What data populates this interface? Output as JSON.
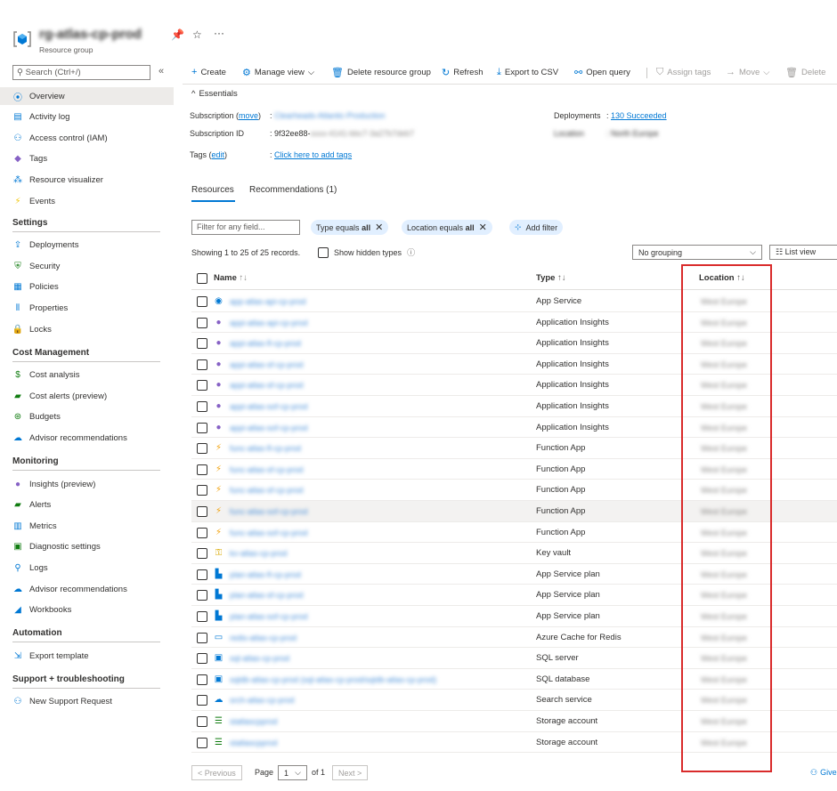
{
  "header": {
    "title": "rg-atlas-cp-prod",
    "subtitle": "Resource group",
    "pin_icon": "pin-icon",
    "star_icon": "star-icon",
    "more_icon": "ellipsis-icon"
  },
  "sidebar": {
    "search_placeholder": "Search (Ctrl+/)",
    "collapse": "«",
    "items": [
      {
        "label": "Overview",
        "icon": "overview-icon",
        "glyph": "⦿",
        "color": "#0078d4"
      },
      {
        "label": "Activity log",
        "icon": "activity-log-icon",
        "glyph": "▤",
        "color": "#0078d4"
      },
      {
        "label": "Access control (IAM)",
        "icon": "iam-icon",
        "glyph": "⚇",
        "color": "#0078d4"
      },
      {
        "label": "Tags",
        "icon": "tag-icon",
        "glyph": "◆",
        "color": "#8661c5"
      },
      {
        "label": "Resource visualizer",
        "icon": "visualizer-icon",
        "glyph": "⁂",
        "color": "#0078d4"
      },
      {
        "label": "Events",
        "icon": "events-icon",
        "glyph": "⚡",
        "color": "#f2c811"
      }
    ],
    "sections": [
      {
        "title": "Settings",
        "items": [
          {
            "label": "Deployments",
            "icon": "deployments-icon",
            "glyph": "⇪",
            "color": "#0078d4"
          },
          {
            "label": "Security",
            "icon": "security-icon",
            "glyph": "⛨",
            "color": "#107c10"
          },
          {
            "label": "Policies",
            "icon": "policies-icon",
            "glyph": "▦",
            "color": "#0078d4"
          },
          {
            "label": "Properties",
            "icon": "properties-icon",
            "glyph": "⦀",
            "color": "#0078d4"
          },
          {
            "label": "Locks",
            "icon": "lock-icon",
            "glyph": "🔒",
            "color": "#0078d4"
          }
        ]
      },
      {
        "title": "Cost Management",
        "items": [
          {
            "label": "Cost analysis",
            "icon": "cost-analysis-icon",
            "glyph": "$",
            "color": "#107c10"
          },
          {
            "label": "Cost alerts (preview)",
            "icon": "cost-alerts-icon",
            "glyph": "▰",
            "color": "#107c10"
          },
          {
            "label": "Budgets",
            "icon": "budgets-icon",
            "glyph": "⊛",
            "color": "#107c10"
          },
          {
            "label": "Advisor recommendations",
            "icon": "advisor-icon",
            "glyph": "☁",
            "color": "#0078d4"
          }
        ]
      },
      {
        "title": "Monitoring",
        "items": [
          {
            "label": "Insights (preview)",
            "icon": "insights-icon",
            "glyph": "●",
            "color": "#8661c5"
          },
          {
            "label": "Alerts",
            "icon": "alerts-icon",
            "glyph": "▰",
            "color": "#107c10"
          },
          {
            "label": "Metrics",
            "icon": "metrics-icon",
            "glyph": "▥",
            "color": "#0078d4"
          },
          {
            "label": "Diagnostic settings",
            "icon": "diagnostic-icon",
            "glyph": "▣",
            "color": "#107c10"
          },
          {
            "label": "Logs",
            "icon": "logs-icon",
            "glyph": "⚲",
            "color": "#0078d4"
          },
          {
            "label": "Advisor recommendations",
            "icon": "advisor-icon",
            "glyph": "☁",
            "color": "#0078d4"
          },
          {
            "label": "Workbooks",
            "icon": "workbooks-icon",
            "glyph": "◢",
            "color": "#0078d4"
          }
        ]
      },
      {
        "title": "Automation",
        "items": [
          {
            "label": "Export template",
            "icon": "export-template-icon",
            "glyph": "⇲",
            "color": "#0078d4"
          }
        ]
      },
      {
        "title": "Support + troubleshooting",
        "items": [
          {
            "label": "New Support Request",
            "icon": "support-icon",
            "glyph": "⚇",
            "color": "#0078d4"
          }
        ]
      }
    ]
  },
  "toolbar": {
    "create": "Create",
    "manage_view": "Manage view",
    "delete_rg": "Delete resource group",
    "refresh": "Refresh",
    "export_csv": "Export to CSV",
    "open_query": "Open query",
    "assign_tags": "Assign tags",
    "move": "Move",
    "delete": "Delete"
  },
  "essentials": {
    "title": "Essentials",
    "subscription_label": "Subscription",
    "subscription_move": "move",
    "subscription_value": "Clearheads-Atlantic-Production",
    "subscription_id_label": "Subscription ID",
    "subscription_id_value": "9f32ee88-",
    "subscription_id_blurred": "xxxx-4141-bbc7-3a27b7deb7",
    "tags_label": "Tags",
    "tags_edit": "edit",
    "tags_value": "Click here to add tags",
    "deployments_label": "Deployments",
    "deployments_value": "130 Succeeded",
    "location_label": "Location",
    "location_value": "North Europe"
  },
  "tabs": {
    "resources": "Resources",
    "recommendations": "Recommendations (1)"
  },
  "filters": {
    "placeholder": "Filter for any field...",
    "type_prefix": "Type equals",
    "type_value": "all",
    "location_prefix": "Location equals",
    "location_value": "all",
    "add_filter": "Add filter"
  },
  "list": {
    "status": "Showing 1 to 25 of 25 records.",
    "show_hidden": "Show hidden types",
    "grouping": "No grouping",
    "view": "List view",
    "col_name": "Name",
    "col_type": "Type",
    "col_location": "Location"
  },
  "rows": [
    {
      "name": "app-atlas-api-cp-prod",
      "type": "App Service",
      "icon": "app-service-icon",
      "glyph": "◉",
      "color": "#0078d4",
      "location": "West Europe"
    },
    {
      "name": "appi-atlas-api-cp-prod",
      "type": "Application Insights",
      "icon": "app-insights-icon",
      "glyph": "●",
      "color": "#8661c5",
      "location": "West Europe"
    },
    {
      "name": "appi-atlas-fl-cp-prod",
      "type": "Application Insights",
      "icon": "app-insights-icon",
      "glyph": "●",
      "color": "#8661c5",
      "location": "West Europe"
    },
    {
      "name": "appi-atlas-sf-cp-prod",
      "type": "Application Insights",
      "icon": "app-insights-icon",
      "glyph": "●",
      "color": "#8661c5",
      "location": "West Europe"
    },
    {
      "name": "appi-atlas-sf-cp-prod",
      "type": "Application Insights",
      "icon": "app-insights-icon",
      "glyph": "●",
      "color": "#8661c5",
      "location": "West Europe"
    },
    {
      "name": "appi-atlas-sof-cp-prod",
      "type": "Application Insights",
      "icon": "app-insights-icon",
      "glyph": "●",
      "color": "#8661c5",
      "location": "West Europe"
    },
    {
      "name": "appi-atlas-sof-cp-prod",
      "type": "Application Insights",
      "icon": "app-insights-icon",
      "glyph": "●",
      "color": "#8661c5",
      "location": "West Europe"
    },
    {
      "name": "func-atlas-fl-cp-prod",
      "type": "Function App",
      "icon": "function-app-icon",
      "glyph": "⚡",
      "color": "#f2a20c",
      "location": "West Europe"
    },
    {
      "name": "func-atlas-sf-cp-prod",
      "type": "Function App",
      "icon": "function-app-icon",
      "glyph": "⚡",
      "color": "#f2a20c",
      "location": "West Europe"
    },
    {
      "name": "func-atlas-sf-cp-prod",
      "type": "Function App",
      "icon": "function-app-icon",
      "glyph": "⚡",
      "color": "#f2a20c",
      "location": "West Europe"
    },
    {
      "name": "func-atlas-sof-cp-prod",
      "type": "Function App",
      "icon": "function-app-icon",
      "glyph": "⚡",
      "color": "#f2a20c",
      "location": "West Europe"
    },
    {
      "name": "func-atlas-sof-cp-prod",
      "type": "Function App",
      "icon": "function-app-icon",
      "glyph": "⚡",
      "color": "#f2a20c",
      "location": "West Europe"
    },
    {
      "name": "kv-atlas-cp-prod",
      "type": "Key vault",
      "icon": "key-vault-icon",
      "glyph": "⚿",
      "color": "#d8a800",
      "location": "West Europe"
    },
    {
      "name": "plan-atlas-fl-cp-prod",
      "type": "App Service plan",
      "icon": "app-service-plan-icon",
      "glyph": "▙",
      "color": "#0078d4",
      "location": "West Europe"
    },
    {
      "name": "plan-atlas-sf-cp-prod",
      "type": "App Service plan",
      "icon": "app-service-plan-icon",
      "glyph": "▙",
      "color": "#0078d4",
      "location": "West Europe"
    },
    {
      "name": "plan-atlas-sof-cp-prod",
      "type": "App Service plan",
      "icon": "app-service-plan-icon",
      "glyph": "▙",
      "color": "#0078d4",
      "location": "West Europe"
    },
    {
      "name": "redis-atlas-cp-prod",
      "type": "Azure Cache for Redis",
      "icon": "redis-icon",
      "glyph": "▭",
      "color": "#0078d4",
      "location": "West Europe"
    },
    {
      "name": "sql-atlas-cp-prod",
      "type": "SQL server",
      "icon": "sql-server-icon",
      "glyph": "▣",
      "color": "#0078d4",
      "location": "West Europe"
    },
    {
      "name": "sqldb-atlas-cp-prod (sql-atlas-cp-prod/sqldb-atlas-cp-prod)",
      "type": "SQL database",
      "icon": "sql-database-icon",
      "glyph": "▣",
      "color": "#0078d4",
      "location": "West Europe"
    },
    {
      "name": "srch-atlas-cp-prod",
      "type": "Search service",
      "icon": "search-service-icon",
      "glyph": "☁",
      "color": "#0078d4",
      "location": "West Europe"
    },
    {
      "name": "statlascpprod",
      "type": "Storage account",
      "icon": "storage-account-icon",
      "glyph": "☰",
      "color": "#107c10",
      "location": "West Europe"
    },
    {
      "name": "statlascpprod",
      "type": "Storage account",
      "icon": "storage-account-icon",
      "glyph": "☰",
      "color": "#107c10",
      "location": "West Europe"
    }
  ],
  "pager": {
    "previous": "< Previous",
    "page_label": "Page",
    "page_value": "1",
    "of": "of 1",
    "next": "Next >",
    "feedback": "Give"
  }
}
